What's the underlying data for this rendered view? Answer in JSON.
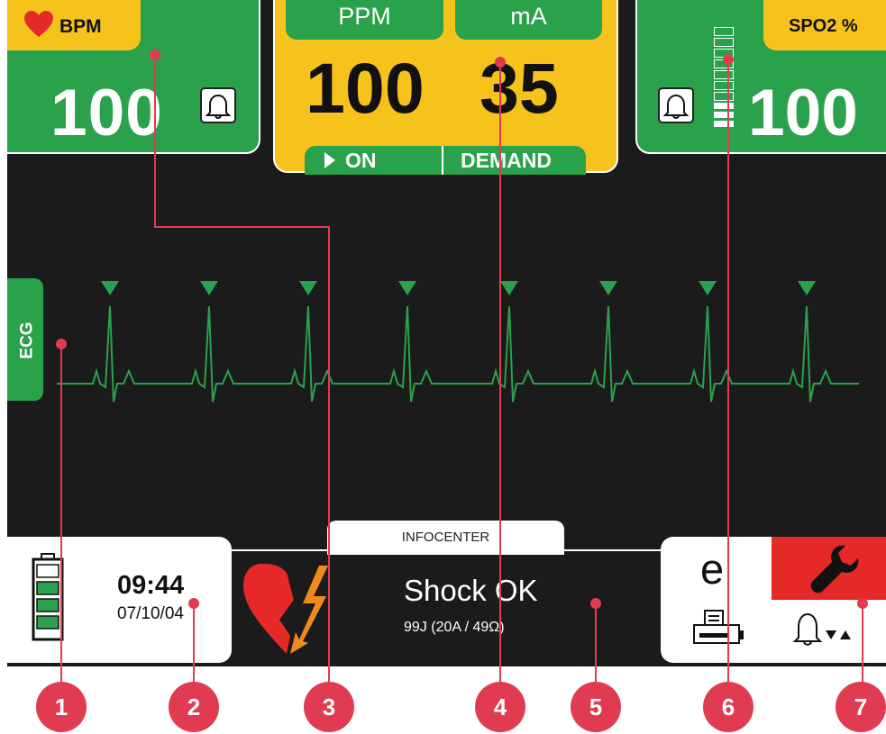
{
  "bpm": {
    "label": "BPM",
    "value": "100"
  },
  "pacer": {
    "ppm_label": "PPM",
    "ma_label": "mA",
    "ppm_value": "100",
    "ma_value": "35",
    "mode_on": "ON",
    "mode_demand": "DEMAND"
  },
  "spo2": {
    "label": "SPO2 %",
    "value": "100"
  },
  "ecg": {
    "label": "ECG",
    "beats": 8
  },
  "status": {
    "time": "09:44",
    "date": "07/10/04",
    "battery_level_segments": 3,
    "battery_total_segments": 4
  },
  "infocenter": {
    "tab_label": "INFOCENTER",
    "message": "Shock OK",
    "detail": "99J (20A / 49Ω)"
  },
  "callouts": [
    "1",
    "2",
    "3",
    "4",
    "5",
    "6",
    "7"
  ],
  "colors": {
    "panel_green": "#2aa24b",
    "pacer_yellow": "#f6c21c",
    "alarm_red": "#e52929",
    "callout_red": "#e13b52",
    "ecg_trace": "#2aa24b"
  }
}
